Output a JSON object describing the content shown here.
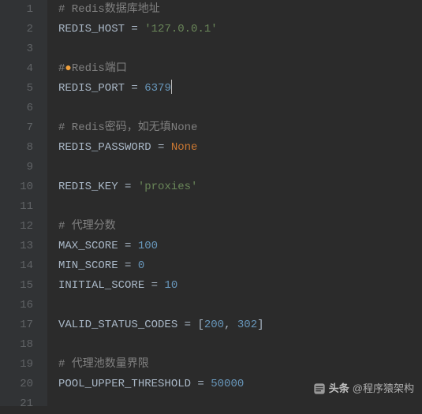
{
  "gutter": {
    "1": "1",
    "2": "2",
    "3": "3",
    "4": "4",
    "5": "5",
    "6": "6",
    "7": "7",
    "8": "8",
    "9": "9",
    "10": "10",
    "11": "11",
    "12": "12",
    "13": "13",
    "14": "14",
    "15": "15",
    "16": "16",
    "17": "17",
    "18": "18",
    "19": "19",
    "20": "20",
    "21": "21"
  },
  "code": {
    "l1_comment": "# Redis数据库地址",
    "l2_ident": "REDIS_HOST",
    "l2_eq": " = ",
    "l2_str": "'127.0.0.1'",
    "l4_hash": "#",
    "l4_rest": "Redis端口",
    "l5_ident": "REDIS_PORT",
    "l5_eq": " = ",
    "l5_num": "6379",
    "l7_comment": "# Redis密码，如无填None",
    "l8_ident": "REDIS_PASSWORD",
    "l8_eq": " = ",
    "l8_kw": "None",
    "l10_ident": "REDIS_KEY",
    "l10_eq": " = ",
    "l10_str": "'proxies'",
    "l12_comment": "# 代理分数",
    "l13_ident": "MAX_SCORE",
    "l13_eq": " = ",
    "l13_num": "100",
    "l14_ident": "MIN_SCORE",
    "l14_eq": " = ",
    "l14_num": "0",
    "l15_ident": "INITIAL_SCORE",
    "l15_eq": " = ",
    "l15_num": "10",
    "l17_ident": "VALID_STATUS_CODES",
    "l17_eq": " = ",
    "l17_lb": "[",
    "l17_n1": "200",
    "l17_comma": ", ",
    "l17_n2": "302",
    "l17_rb": "]",
    "l19_comment": "# 代理池数量界限",
    "l20_ident": "POOL_UPPER_THRESHOLD",
    "l20_eq": " = ",
    "l20_num": "50000"
  },
  "watermark": {
    "brand": "头条",
    "handle": "@程序猿架构"
  }
}
